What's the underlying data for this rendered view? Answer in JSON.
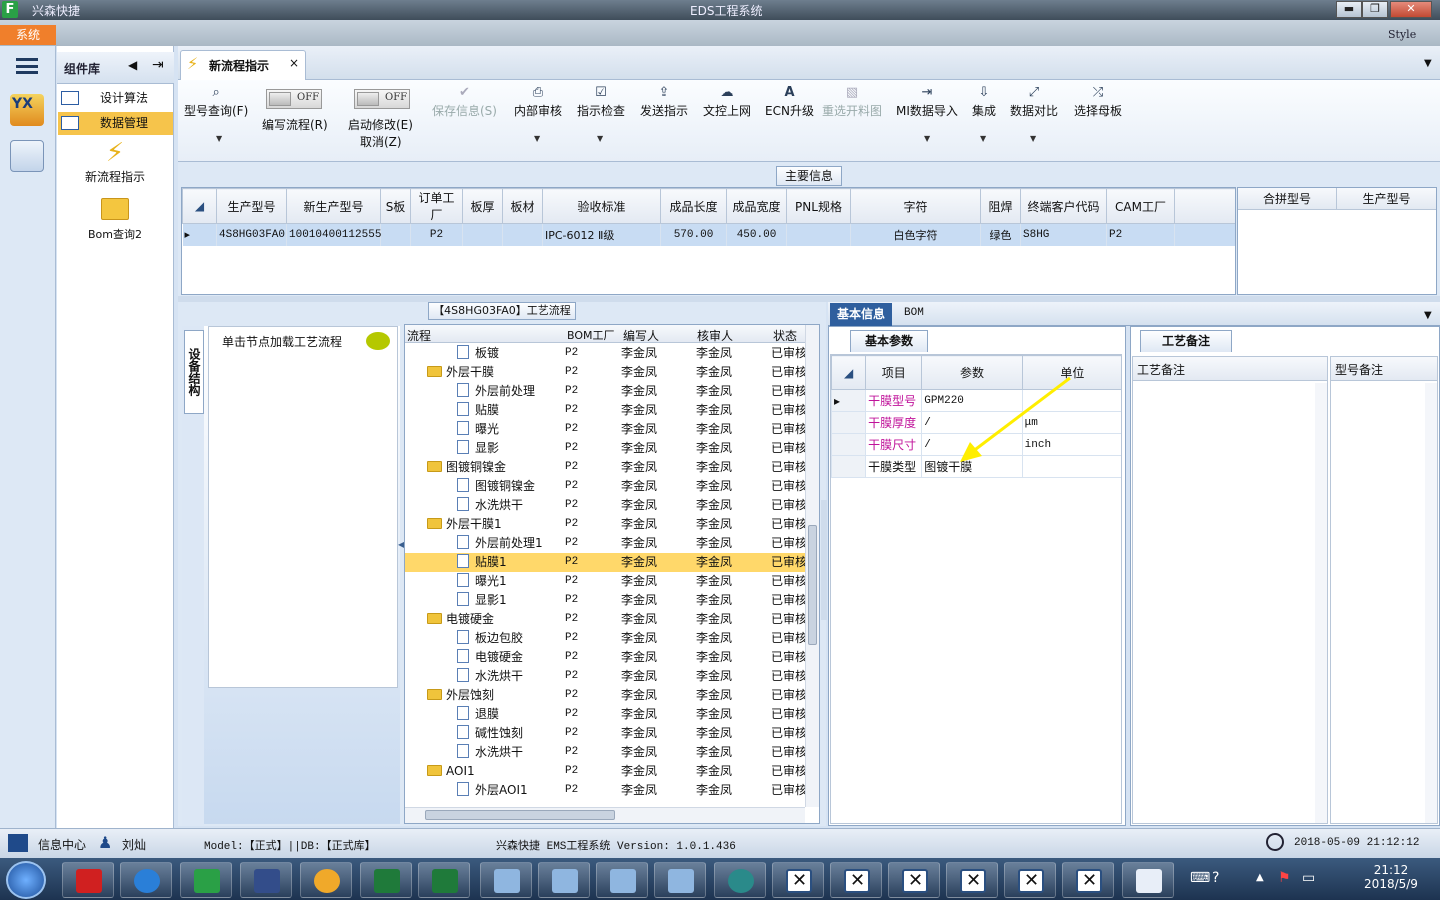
{
  "window": {
    "app_name": "兴森快捷",
    "title": "EDS工程系统",
    "buttons": {
      "minimize": "▬",
      "maximize": "❐",
      "close": "✕"
    }
  },
  "menu": {
    "system": "系统",
    "style": "Style"
  },
  "components": {
    "title": "组件库",
    "items": [
      {
        "label": "设计算法"
      },
      {
        "label": "数据管理"
      }
    ],
    "launchers": [
      {
        "label": "新流程指示"
      },
      {
        "label": "Bom查询2"
      }
    ]
  },
  "document_tab": {
    "label": "新流程指示",
    "close": "×"
  },
  "ribbon": {
    "model_query": "型号查询(F)",
    "write_flow": "编写流程(R)",
    "start_modify": "启动修改(E)",
    "cancel": "取消(Z)",
    "toggle_off": "OFF",
    "buttons": [
      {
        "label": "保存信息(S)",
        "icon": "check-icon",
        "glyph": "✔",
        "disabled": true
      },
      {
        "label": "内部审核",
        "icon": "printer-icon",
        "glyph": "⎙",
        "disabled": false
      },
      {
        "label": "指示检查",
        "icon": "checkbox-icon",
        "glyph": "☑",
        "disabled": false
      },
      {
        "label": "发送指示",
        "icon": "upload-icon",
        "glyph": "⇪",
        "disabled": false
      },
      {
        "label": "文控上网",
        "icon": "cloud-upload-icon",
        "glyph": "☁",
        "disabled": false
      },
      {
        "label": "ECN升级",
        "icon": "ecn-icon",
        "glyph": "A",
        "disabled": false
      },
      {
        "label": "重选开料图",
        "icon": "image-icon",
        "glyph": "▧",
        "disabled": true
      },
      {
        "label": "MI数据导入",
        "icon": "import-icon",
        "glyph": "⇥",
        "disabled": false
      },
      {
        "label": "集成",
        "icon": "download-icon",
        "glyph": "⇩",
        "disabled": false
      },
      {
        "label": "数据对比",
        "icon": "compare-icon",
        "glyph": "⤢",
        "disabled": false
      },
      {
        "label": "选择母板",
        "icon": "shuffle-icon",
        "glyph": "⤮",
        "disabled": false
      }
    ]
  },
  "main_info": {
    "title": "主要信息",
    "columns": [
      "生产型号",
      "新生产型号",
      "S板",
      "订单工厂",
      "板厚",
      "板材",
      "验收标准",
      "成品长度",
      "成品宽度",
      "PNL规格",
      "字符",
      "阻焊",
      "终端客户代码",
      "CAM工厂"
    ],
    "row": [
      "4S8HG03FA0",
      "10010400112555",
      "",
      "P2",
      "",
      "",
      "IPC-6012 Ⅱ级",
      "570.00",
      "450.00",
      "",
      "白色字符",
      "绿色",
      "S8HG",
      "P2"
    ],
    "side_columns": [
      "合拼型号",
      "生产型号"
    ]
  },
  "process": {
    "title": "【4S8HG03FA0】工艺流程",
    "vertical_tab": "设备结构",
    "hint": "单击节点加载工艺流程",
    "columns": [
      "流程",
      "BOM工厂",
      "编写人",
      "核审人",
      "状态"
    ],
    "rows": [
      {
        "name": "板镀",
        "level": 2,
        "folder": false,
        "bom": "P2",
        "editor": "李金凤",
        "reviewer": "李金凤",
        "status": "已审核"
      },
      {
        "name": "外层干膜",
        "level": 1,
        "folder": true,
        "bom": "P2",
        "editor": "李金凤",
        "reviewer": "李金凤",
        "status": "已审核"
      },
      {
        "name": "外层前处理",
        "level": 2,
        "folder": false,
        "bom": "P2",
        "editor": "李金凤",
        "reviewer": "李金凤",
        "status": "已审核"
      },
      {
        "name": "贴膜",
        "level": 2,
        "folder": false,
        "bom": "P2",
        "editor": "李金凤",
        "reviewer": "李金凤",
        "status": "已审核"
      },
      {
        "name": "曝光",
        "level": 2,
        "folder": false,
        "bom": "P2",
        "editor": "李金凤",
        "reviewer": "李金凤",
        "status": "已审核"
      },
      {
        "name": "显影",
        "level": 2,
        "folder": false,
        "bom": "P2",
        "editor": "李金凤",
        "reviewer": "李金凤",
        "status": "已审核"
      },
      {
        "name": "图镀铜镍金",
        "level": 1,
        "folder": true,
        "bom": "P2",
        "editor": "李金凤",
        "reviewer": "李金凤",
        "status": "已审核"
      },
      {
        "name": "图镀铜镍金",
        "level": 2,
        "folder": false,
        "bom": "P2",
        "editor": "李金凤",
        "reviewer": "李金凤",
        "status": "已审核"
      },
      {
        "name": "水洗烘干",
        "level": 2,
        "folder": false,
        "bom": "P2",
        "editor": "李金凤",
        "reviewer": "李金凤",
        "status": "已审核"
      },
      {
        "name": "外层干膜1",
        "level": 1,
        "folder": true,
        "bom": "P2",
        "editor": "李金凤",
        "reviewer": "李金凤",
        "status": "已审核"
      },
      {
        "name": "外层前处理1",
        "level": 2,
        "folder": false,
        "bom": "P2",
        "editor": "李金凤",
        "reviewer": "李金凤",
        "status": "已审核"
      },
      {
        "name": "贴膜1",
        "level": 2,
        "folder": false,
        "bom": "P2",
        "editor": "李金凤",
        "reviewer": "李金凤",
        "status": "已审核",
        "selected": true
      },
      {
        "name": "曝光1",
        "level": 2,
        "folder": false,
        "bom": "P2",
        "editor": "李金凤",
        "reviewer": "李金凤",
        "status": "已审核"
      },
      {
        "name": "显影1",
        "level": 2,
        "folder": false,
        "bom": "P2",
        "editor": "李金凤",
        "reviewer": "李金凤",
        "status": "已审核"
      },
      {
        "name": "电镀硬金",
        "level": 1,
        "folder": true,
        "bom": "P2",
        "editor": "李金凤",
        "reviewer": "李金凤",
        "status": "已审核"
      },
      {
        "name": "板边包胶",
        "level": 2,
        "folder": false,
        "bom": "P2",
        "editor": "李金凤",
        "reviewer": "李金凤",
        "status": "已审核"
      },
      {
        "name": "电镀硬金",
        "level": 2,
        "folder": false,
        "bom": "P2",
        "editor": "李金凤",
        "reviewer": "李金凤",
        "status": "已审核"
      },
      {
        "name": "水洗烘干",
        "level": 2,
        "folder": false,
        "bom": "P2",
        "editor": "李金凤",
        "reviewer": "李金凤",
        "status": "已审核"
      },
      {
        "name": "外层蚀刻",
        "level": 1,
        "folder": true,
        "bom": "P2",
        "editor": "李金凤",
        "reviewer": "李金凤",
        "status": "已审核"
      },
      {
        "name": "退膜",
        "level": 2,
        "folder": false,
        "bom": "P2",
        "editor": "李金凤",
        "reviewer": "李金凤",
        "status": "已审核"
      },
      {
        "name": "碱性蚀刻",
        "level": 2,
        "folder": false,
        "bom": "P2",
        "editor": "李金凤",
        "reviewer": "李金凤",
        "status": "已审核"
      },
      {
        "name": "水洗烘干",
        "level": 2,
        "folder": false,
        "bom": "P2",
        "editor": "李金凤",
        "reviewer": "李金凤",
        "status": "已审核"
      },
      {
        "name": "AOI1",
        "level": 1,
        "folder": true,
        "bom": "P2",
        "editor": "李金凤",
        "reviewer": "李金凤",
        "status": "已审核"
      },
      {
        "name": "外层AOI1",
        "level": 2,
        "folder": false,
        "bom": "P2",
        "editor": "李金凤",
        "reviewer": "李金凤",
        "status": "已审核"
      }
    ]
  },
  "info_tabs": {
    "basic": "基本信息",
    "bom": "BOM"
  },
  "basic_params": {
    "tab": "基本参数",
    "columns": [
      "项目",
      "参数",
      "单位"
    ],
    "rows": [
      {
        "item": "干膜型号",
        "param": "GPM220",
        "unit": "",
        "highlight": true
      },
      {
        "item": "干膜厚度",
        "param": "/",
        "unit": "μm",
        "highlight": true
      },
      {
        "item": "干膜尺寸",
        "param": "/",
        "unit": "inch",
        "highlight": true
      },
      {
        "item": "干膜类型",
        "param": "图镀干膜",
        "unit": "",
        "highlight": false
      }
    ]
  },
  "notes": {
    "tab": "工艺备注",
    "process_note": "工艺备注",
    "model_note": "型号备注"
  },
  "status_bar": {
    "info_center": "信息中心",
    "user": "刘灿",
    "model_db": "Model:【正式】||DB:【正式库】",
    "version": "兴森快捷 EMS工程系统 Version: 1.0.1.436",
    "datetime": "2018-05-09 21:12:12"
  },
  "taskbar": {
    "time": "21:12",
    "date": "2018/5/9"
  },
  "colors": {
    "accent_orange": "#f07f2b",
    "selected_row": "#ffd86a",
    "grid_row": "#c8dcf3",
    "highlight_text": "#c0129a",
    "arrow": "#ffee00"
  }
}
